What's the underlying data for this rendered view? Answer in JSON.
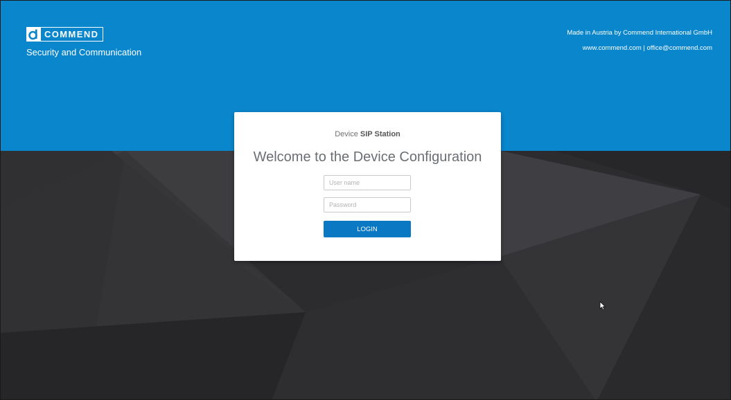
{
  "brand": {
    "logo_text": "COMMEND",
    "tagline": "Security and Communication"
  },
  "credits": {
    "line1": "Made in Austria by Commend International GmbH",
    "line2": "www.commend.com | office@commend.com"
  },
  "login": {
    "device_prefix": "Device",
    "device_name": "SIP Station",
    "welcome": "Welcome to the Device Configuration",
    "username_placeholder": "User name",
    "username_value": "",
    "password_placeholder": "Password",
    "password_value": "",
    "login_label": "LOGIN"
  },
  "colors": {
    "header_blue": "#0a86cc",
    "button_blue": "#0a78c2",
    "background_dark": "#2b2b2d"
  },
  "icons": {
    "logo": "commend-d-logo-icon",
    "cursor": "mouse-pointer-icon"
  }
}
